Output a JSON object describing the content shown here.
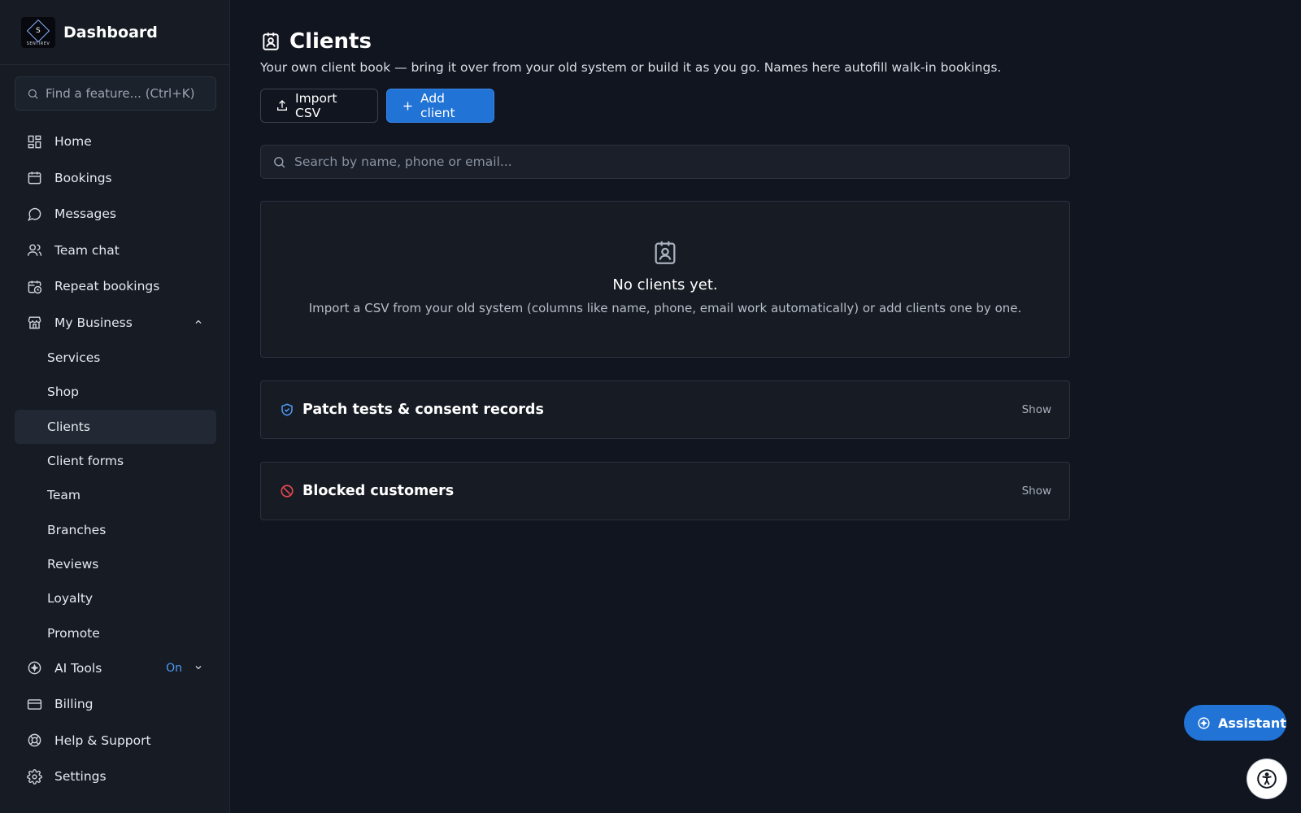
{
  "brand": {
    "title": "Dashboard",
    "logo_letter": "S",
    "logo_text": "SENTIREV"
  },
  "sidebar": {
    "search_placeholder": "Find a feature... (Ctrl+K)",
    "items": [
      {
        "label": "Home",
        "icon": "grid-icon"
      },
      {
        "label": "Bookings",
        "icon": "calendar-icon"
      },
      {
        "label": "Messages",
        "icon": "chat-bubble-icon"
      },
      {
        "label": "Team chat",
        "icon": "users-icon"
      },
      {
        "label": "Repeat bookings",
        "icon": "calendar-clock-icon"
      },
      {
        "label": "My Business",
        "icon": "store-icon"
      }
    ],
    "business_sub": [
      "Services",
      "Shop",
      "Clients",
      "Client forms",
      "Team",
      "Branches",
      "Reviews",
      "Loyalty",
      "Promote"
    ],
    "active_sub": "Clients",
    "ai_tools": {
      "label": "AI Tools",
      "status": "On"
    },
    "bottom_items": [
      {
        "label": "Billing",
        "icon": "credit-card-icon"
      },
      {
        "label": "Help & Support",
        "icon": "lifebuoy-icon"
      },
      {
        "label": "Settings",
        "icon": "gear-icon"
      }
    ]
  },
  "main": {
    "title": "Clients",
    "subtitle": "Your own client book — bring it over from your old system or build it as you go. Names here autofill walk-in bookings.",
    "import_label": "Import CSV",
    "add_label": "Add client",
    "search_placeholder": "Search by name, phone or email...",
    "empty_title": "No clients yet.",
    "empty_desc": "Import a CSV from your old system (columns like name, phone, email work automatically) or add clients one by one.",
    "sections": [
      {
        "title": "Patch tests & consent records",
        "action": "Show"
      },
      {
        "title": "Blocked customers",
        "action": "Show"
      }
    ]
  },
  "assistant": {
    "label": "Assistant"
  },
  "colors": {
    "accent": "#2173d6",
    "on_badge": "#4f9cf5",
    "blocked": "#e5484d",
    "shield": "#4f9cf5"
  }
}
